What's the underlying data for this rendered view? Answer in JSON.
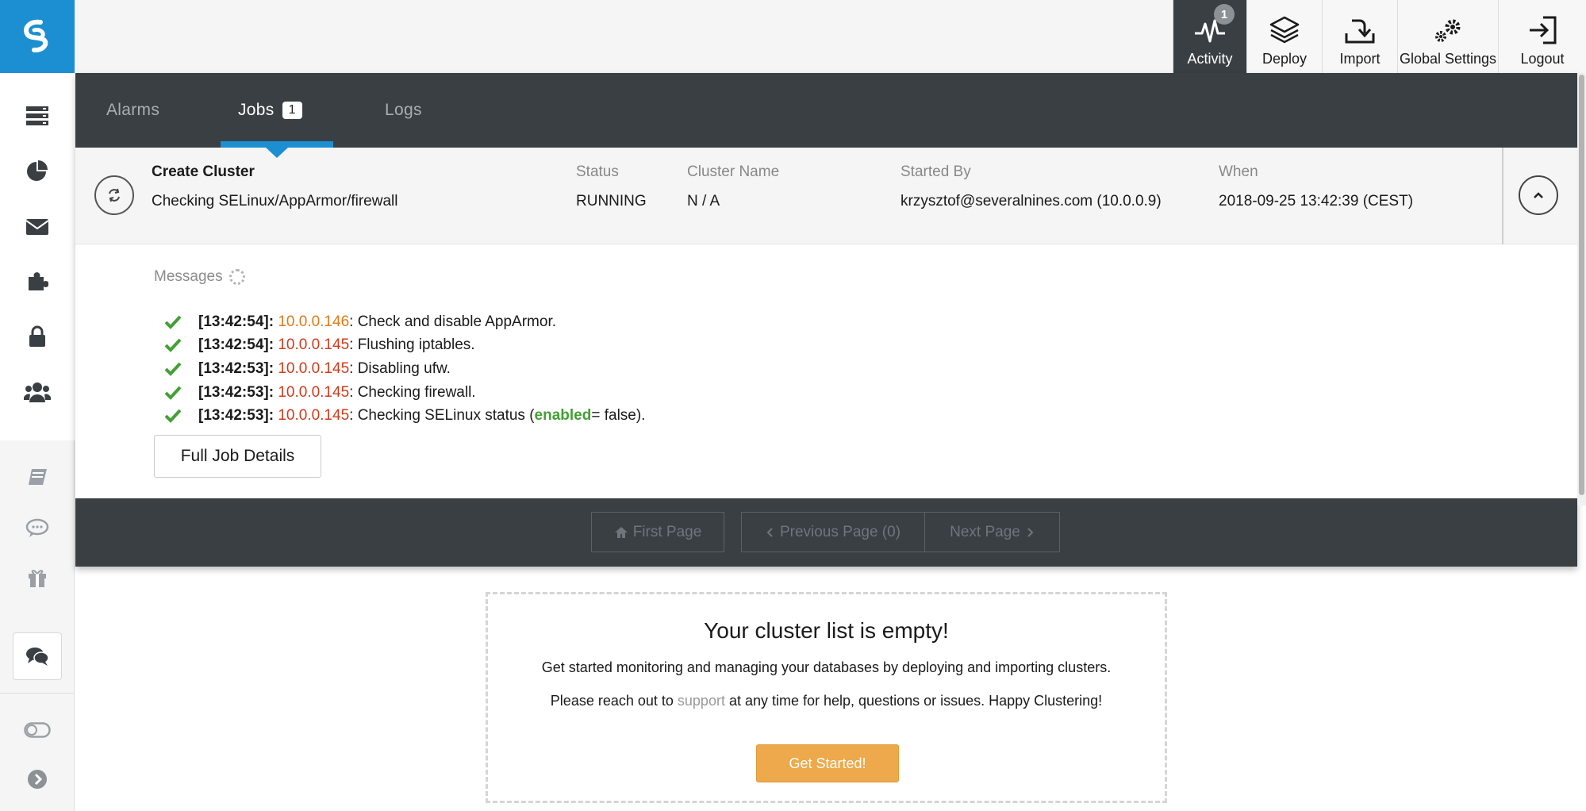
{
  "colors": {
    "accent": "#1b8fd1",
    "panel_dark": "#3a3f44",
    "success": "#43a036",
    "ip_red": "#d13b1b",
    "ip_orange": "#e07a18",
    "cta": "#eda94b"
  },
  "sidebar": {
    "items": [
      "clusters-icon",
      "dashboard-pie-icon",
      "mail-icon",
      "puzzle-icon",
      "lock-icon",
      "users-icon"
    ],
    "lower_items": [
      "book-icon",
      "comment-icon",
      "gift-icon"
    ],
    "chat_icon": "chat-bubbles-icon",
    "toggle_icon": "toggle-icon",
    "expand_icon": "chevron-right-circle-icon"
  },
  "topnav": {
    "activity": {
      "label": "Activity",
      "badge": "1"
    },
    "deploy": {
      "label": "Deploy"
    },
    "import": {
      "label": "Import"
    },
    "settings": {
      "label": "Global Settings"
    },
    "logout": {
      "label": "Logout"
    }
  },
  "tabs": {
    "alarms": "Alarms",
    "jobs": "Jobs",
    "jobs_count": "1",
    "logs": "Logs"
  },
  "job": {
    "name": "Create Cluster",
    "description": "Checking SELinux/AppArmor/firewall",
    "status_label": "Status",
    "status": "RUNNING",
    "cluster_name_label": "Cluster Name",
    "cluster_name": "N / A",
    "started_by_label": "Started By",
    "started_by": "krzysztof@severalnines.com (10.0.0.9)",
    "when_label": "When",
    "when": "2018-09-25 13:42:39 (CEST)"
  },
  "messages": {
    "title": "Messages",
    "items": [
      {
        "ts": "[13:42:54]:",
        "ip": "10.0.0.146",
        "text": ": Check and disable AppArmor."
      },
      {
        "ts": "[13:42:54]:",
        "ip": "10.0.0.145",
        "text": ": Flushing iptables."
      },
      {
        "ts": "[13:42:53]:",
        "ip": "10.0.0.145",
        "text": ": Disabling ufw."
      },
      {
        "ts": "[13:42:53]:",
        "ip": "10.0.0.145",
        "text": ": Checking firewall."
      },
      {
        "ts": "[13:42:53]:",
        "ip": "10.0.0.145",
        "text_before": ": Checking SELinux status (",
        "keyword": "enabled",
        "text_after": " = false)."
      }
    ],
    "full_details_label": "Full Job Details"
  },
  "pager": {
    "first": "First Page",
    "previous": "Previous Page (0)",
    "next": "Next Page"
  },
  "empty": {
    "title": "Your cluster list is empty!",
    "line1": "Get started monitoring and managing your databases by deploying and importing clusters.",
    "line2_before": "Please reach out to ",
    "line2_link": "support",
    "line2_after": " at any time for help, questions or issues. Happy Clustering!",
    "cta": "Get Started!"
  }
}
